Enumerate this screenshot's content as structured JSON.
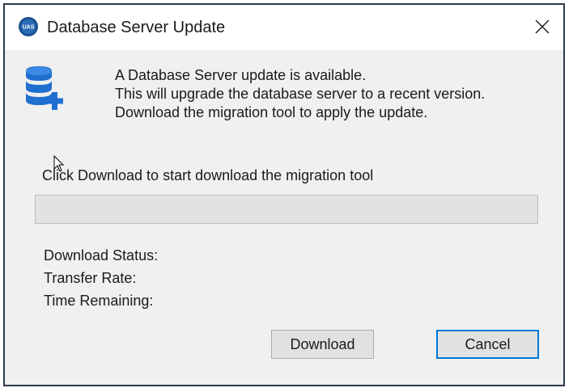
{
  "window": {
    "title": "Database Server Update",
    "app_icon_text": "UAS"
  },
  "message": {
    "line1": "A Database Server update is available.",
    "line2": "This will upgrade the database server to a recent version.",
    "line3": "Download the migration tool to apply the update."
  },
  "instruction": "Click Download to start download the migration tool",
  "progress": {
    "fraction": 0
  },
  "status": {
    "download_status_label": "Download Status:",
    "transfer_rate_label": "Transfer Rate:",
    "time_remaining_label": "Time Remaining:"
  },
  "buttons": {
    "download_label": "Download",
    "cancel_label": "Cancel"
  },
  "colors": {
    "accent": "#0078d7",
    "db_icon": "#1e6fd0"
  },
  "icons": {
    "app": "uas-logo-icon",
    "close": "close-icon",
    "database": "database-add-icon",
    "cursor": "mouse-pointer-icon"
  }
}
